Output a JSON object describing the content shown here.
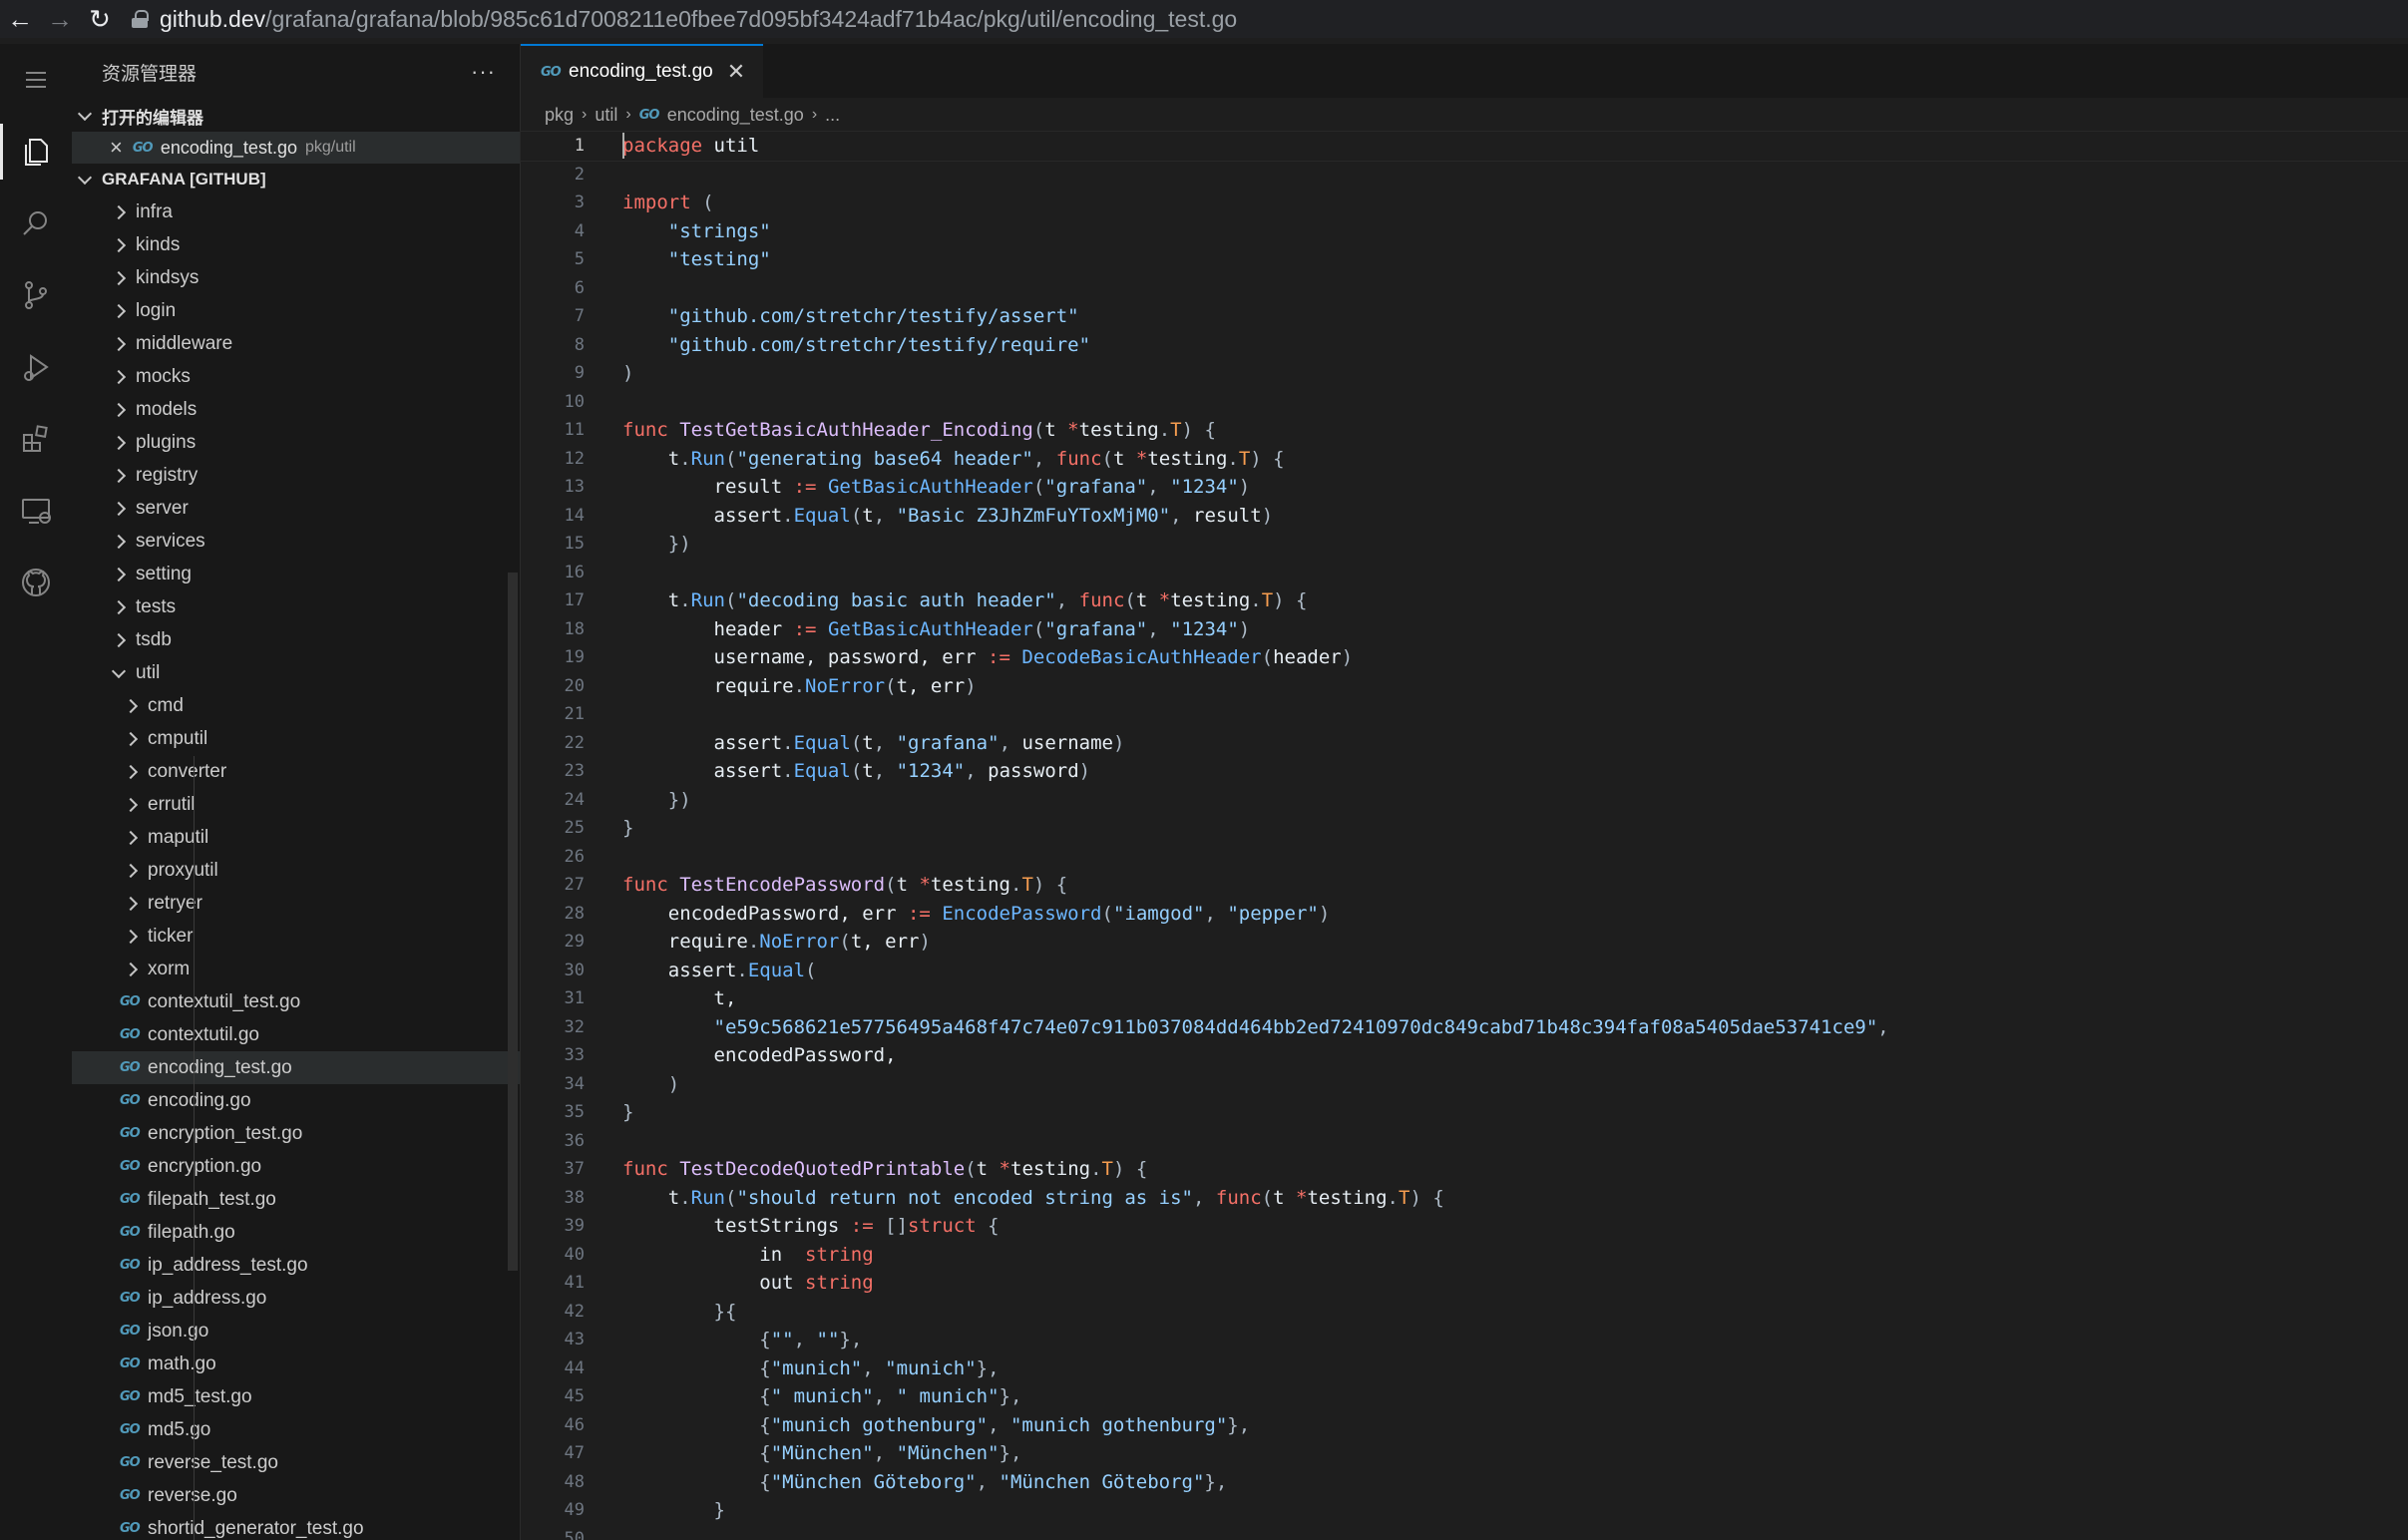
{
  "browser": {
    "back_icon": "arrow-left-icon",
    "forward_icon": "arrow-right-icon",
    "reload_icon": "reload-icon",
    "url_host": "github.dev",
    "url_path": "/grafana/grafana/blob/985c61d7008211e0fbee7d095bf3424adf71b4ac/pkg/util/encoding_test.go"
  },
  "activity_bar": [
    "explorer-icon",
    "search-icon",
    "source-control-icon",
    "run-debug-icon",
    "extensions-icon",
    "remote-explorer-icon",
    "github-icon"
  ],
  "sidebar": {
    "title": "资源管理器",
    "more": "···",
    "open_editors_label": "打开的编辑器",
    "open_editor": {
      "name": "encoding_test.go",
      "path": "pkg/util"
    },
    "repo_label": "GRAFANA [GITHUB]",
    "folders": [
      "infra",
      "kinds",
      "kindsys",
      "login",
      "middleware",
      "mocks",
      "models",
      "plugins",
      "registry",
      "server",
      "services",
      "setting",
      "tests",
      "tsdb"
    ],
    "open_folder": "util",
    "subfolders": [
      "cmd",
      "cmputil",
      "converter",
      "errutil",
      "maputil",
      "proxyutil",
      "retryer",
      "ticker",
      "xorm"
    ],
    "files": [
      "contextutil_test.go",
      "contextutil.go",
      "encoding_test.go",
      "encoding.go",
      "encryption_test.go",
      "encryption.go",
      "filepath_test.go",
      "filepath.go",
      "ip_address_test.go",
      "ip_address.go",
      "json.go",
      "math.go",
      "md5_test.go",
      "md5.go",
      "reverse_test.go",
      "reverse.go",
      "shortid_generator_test.go"
    ],
    "selected_file": "encoding_test.go"
  },
  "editor": {
    "tab": {
      "name": "encoding_test.go",
      "close": "✕"
    },
    "breadcrumb": [
      "pkg",
      "util",
      "encoding_test.go",
      "..."
    ],
    "lines": [
      [
        [
          "kw",
          "package"
        ],
        [
          "id",
          " util"
        ]
      ],
      [],
      [
        [
          "kw",
          "import"
        ],
        [
          "pun",
          " ("
        ]
      ],
      [
        [
          "id",
          "    "
        ],
        [
          "str",
          "\"strings\""
        ]
      ],
      [
        [
          "id",
          "    "
        ],
        [
          "str",
          "\"testing\""
        ]
      ],
      [],
      [
        [
          "id",
          "    "
        ],
        [
          "str",
          "\"github.com/stretchr/testify/assert\""
        ]
      ],
      [
        [
          "id",
          "    "
        ],
        [
          "str",
          "\"github.com/stretchr/testify/require\""
        ]
      ],
      [
        [
          "pun",
          ")"
        ]
      ],
      [],
      [
        [
          "kw",
          "func"
        ],
        [
          "id",
          " "
        ],
        [
          "fn",
          "TestGetBasicAuthHeader_Encoding"
        ],
        [
          "pun",
          "("
        ],
        [
          "id",
          "t "
        ],
        [
          "op",
          "*"
        ],
        [
          "id",
          "testing"
        ],
        [
          "pun",
          "."
        ],
        [
          "type",
          "T"
        ],
        [
          "pun",
          ") {"
        ]
      ],
      [
        [
          "id",
          "    t"
        ],
        [
          "pun",
          "."
        ],
        [
          "call",
          "Run"
        ],
        [
          "pun",
          "("
        ],
        [
          "str",
          "\"generating base64 header\""
        ],
        [
          "pun",
          ", "
        ],
        [
          "kw",
          "func"
        ],
        [
          "pun",
          "("
        ],
        [
          "id",
          "t "
        ],
        [
          "op",
          "*"
        ],
        [
          "id",
          "testing"
        ],
        [
          "pun",
          "."
        ],
        [
          "type",
          "T"
        ],
        [
          "pun",
          ") {"
        ]
      ],
      [
        [
          "id",
          "        result "
        ],
        [
          "op",
          ":="
        ],
        [
          "id",
          " "
        ],
        [
          "call",
          "GetBasicAuthHeader"
        ],
        [
          "pun",
          "("
        ],
        [
          "str",
          "\"grafana\""
        ],
        [
          "pun",
          ", "
        ],
        [
          "str",
          "\"1234\""
        ],
        [
          "pun",
          ")"
        ]
      ],
      [
        [
          "id",
          "        assert"
        ],
        [
          "pun",
          "."
        ],
        [
          "call",
          "Equal"
        ],
        [
          "pun",
          "("
        ],
        [
          "id",
          "t"
        ],
        [
          "pun",
          ", "
        ],
        [
          "str",
          "\"Basic Z3JhZmFuYToxMjM0\""
        ],
        [
          "pun",
          ", "
        ],
        [
          "id",
          "result"
        ],
        [
          "pun",
          ")"
        ]
      ],
      [
        [
          "pun",
          "    })"
        ]
      ],
      [],
      [
        [
          "id",
          "    t"
        ],
        [
          "pun",
          "."
        ],
        [
          "call",
          "Run"
        ],
        [
          "pun",
          "("
        ],
        [
          "str",
          "\"decoding basic auth header\""
        ],
        [
          "pun",
          ", "
        ],
        [
          "kw",
          "func"
        ],
        [
          "pun",
          "("
        ],
        [
          "id",
          "t "
        ],
        [
          "op",
          "*"
        ],
        [
          "id",
          "testing"
        ],
        [
          "pun",
          "."
        ],
        [
          "type",
          "T"
        ],
        [
          "pun",
          ") {"
        ]
      ],
      [
        [
          "id",
          "        header "
        ],
        [
          "op",
          ":="
        ],
        [
          "id",
          " "
        ],
        [
          "call",
          "GetBasicAuthHeader"
        ],
        [
          "pun",
          "("
        ],
        [
          "str",
          "\"grafana\""
        ],
        [
          "pun",
          ", "
        ],
        [
          "str",
          "\"1234\""
        ],
        [
          "pun",
          ")"
        ]
      ],
      [
        [
          "id",
          "        username, password, err "
        ],
        [
          "op",
          ":="
        ],
        [
          "id",
          " "
        ],
        [
          "call",
          "DecodeBasicAuthHeader"
        ],
        [
          "pun",
          "("
        ],
        [
          "id",
          "header"
        ],
        [
          "pun",
          ")"
        ]
      ],
      [
        [
          "id",
          "        require"
        ],
        [
          "pun",
          "."
        ],
        [
          "call",
          "NoError"
        ],
        [
          "pun",
          "("
        ],
        [
          "id",
          "t, err"
        ],
        [
          "pun",
          ")"
        ]
      ],
      [],
      [
        [
          "id",
          "        assert"
        ],
        [
          "pun",
          "."
        ],
        [
          "call",
          "Equal"
        ],
        [
          "pun",
          "("
        ],
        [
          "id",
          "t"
        ],
        [
          "pun",
          ", "
        ],
        [
          "str",
          "\"grafana\""
        ],
        [
          "pun",
          ", "
        ],
        [
          "id",
          "username"
        ],
        [
          "pun",
          ")"
        ]
      ],
      [
        [
          "id",
          "        assert"
        ],
        [
          "pun",
          "."
        ],
        [
          "call",
          "Equal"
        ],
        [
          "pun",
          "("
        ],
        [
          "id",
          "t"
        ],
        [
          "pun",
          ", "
        ],
        [
          "str",
          "\"1234\""
        ],
        [
          "pun",
          ", "
        ],
        [
          "id",
          "password"
        ],
        [
          "pun",
          ")"
        ]
      ],
      [
        [
          "pun",
          "    })"
        ]
      ],
      [
        [
          "pun",
          "}"
        ]
      ],
      [],
      [
        [
          "kw",
          "func"
        ],
        [
          "id",
          " "
        ],
        [
          "fn",
          "TestEncodePassword"
        ],
        [
          "pun",
          "("
        ],
        [
          "id",
          "t "
        ],
        [
          "op",
          "*"
        ],
        [
          "id",
          "testing"
        ],
        [
          "pun",
          "."
        ],
        [
          "type",
          "T"
        ],
        [
          "pun",
          ") {"
        ]
      ],
      [
        [
          "id",
          "    encodedPassword, err "
        ],
        [
          "op",
          ":="
        ],
        [
          "id",
          " "
        ],
        [
          "call",
          "EncodePassword"
        ],
        [
          "pun",
          "("
        ],
        [
          "str",
          "\"iamgod\""
        ],
        [
          "pun",
          ", "
        ],
        [
          "str",
          "\"pepper\""
        ],
        [
          "pun",
          ")"
        ]
      ],
      [
        [
          "id",
          "    require"
        ],
        [
          "pun",
          "."
        ],
        [
          "call",
          "NoError"
        ],
        [
          "pun",
          "("
        ],
        [
          "id",
          "t, err"
        ],
        [
          "pun",
          ")"
        ]
      ],
      [
        [
          "id",
          "    assert"
        ],
        [
          "pun",
          "."
        ],
        [
          "call",
          "Equal"
        ],
        [
          "pun",
          "("
        ]
      ],
      [
        [
          "id",
          "        t,"
        ]
      ],
      [
        [
          "id",
          "        "
        ],
        [
          "str",
          "\"e59c568621e57756495a468f47c74e07c911b037084dd464bb2ed72410970dc849cabd71b48c394faf08a5405dae53741ce9\""
        ],
        [
          "pun",
          ","
        ]
      ],
      [
        [
          "id",
          "        encodedPassword,"
        ]
      ],
      [
        [
          "pun",
          "    )"
        ]
      ],
      [
        [
          "pun",
          "}"
        ]
      ],
      [],
      [
        [
          "kw",
          "func"
        ],
        [
          "id",
          " "
        ],
        [
          "fn",
          "TestDecodeQuotedPrintable"
        ],
        [
          "pun",
          "("
        ],
        [
          "id",
          "t "
        ],
        [
          "op",
          "*"
        ],
        [
          "id",
          "testing"
        ],
        [
          "pun",
          "."
        ],
        [
          "type",
          "T"
        ],
        [
          "pun",
          ") {"
        ]
      ],
      [
        [
          "id",
          "    t"
        ],
        [
          "pun",
          "."
        ],
        [
          "call",
          "Run"
        ],
        [
          "pun",
          "("
        ],
        [
          "str",
          "\"should return not encoded string as is\""
        ],
        [
          "pun",
          ", "
        ],
        [
          "kw",
          "func"
        ],
        [
          "pun",
          "("
        ],
        [
          "id",
          "t "
        ],
        [
          "op",
          "*"
        ],
        [
          "id",
          "testing"
        ],
        [
          "pun",
          "."
        ],
        [
          "type",
          "T"
        ],
        [
          "pun",
          ") {"
        ]
      ],
      [
        [
          "id",
          "        testStrings "
        ],
        [
          "op",
          ":="
        ],
        [
          "id",
          " "
        ],
        [
          "pun",
          "[]"
        ],
        [
          "kw",
          "struct"
        ],
        [
          "pun",
          " {"
        ]
      ],
      [
        [
          "id",
          "            in  "
        ],
        [
          "kw",
          "string"
        ]
      ],
      [
        [
          "id",
          "            out "
        ],
        [
          "kw",
          "string"
        ]
      ],
      [
        [
          "pun",
          "        }{"
        ]
      ],
      [
        [
          "pun",
          "            {"
        ],
        [
          "str",
          "\"\""
        ],
        [
          "pun",
          ", "
        ],
        [
          "str",
          "\"\""
        ],
        [
          "pun",
          "},"
        ]
      ],
      [
        [
          "pun",
          "            {"
        ],
        [
          "str",
          "\"munich\""
        ],
        [
          "pun",
          ", "
        ],
        [
          "str",
          "\"munich\""
        ],
        [
          "pun",
          "},"
        ]
      ],
      [
        [
          "pun",
          "            {"
        ],
        [
          "str",
          "\" munich\""
        ],
        [
          "pun",
          ", "
        ],
        [
          "str",
          "\" munich\""
        ],
        [
          "pun",
          "},"
        ]
      ],
      [
        [
          "pun",
          "            {"
        ],
        [
          "str",
          "\"munich gothenburg\""
        ],
        [
          "pun",
          ", "
        ],
        [
          "str",
          "\"munich gothenburg\""
        ],
        [
          "pun",
          "},"
        ]
      ],
      [
        [
          "pun",
          "            {"
        ],
        [
          "str",
          "\"München\""
        ],
        [
          "pun",
          ", "
        ],
        [
          "str",
          "\"München\""
        ],
        [
          "pun",
          "},"
        ]
      ],
      [
        [
          "pun",
          "            {"
        ],
        [
          "str",
          "\"München Göteborg\""
        ],
        [
          "pun",
          ", "
        ],
        [
          "str",
          "\"München Göteborg\""
        ],
        [
          "pun",
          "},"
        ]
      ],
      [
        [
          "pun",
          "        }"
        ]
      ],
      []
    ]
  }
}
